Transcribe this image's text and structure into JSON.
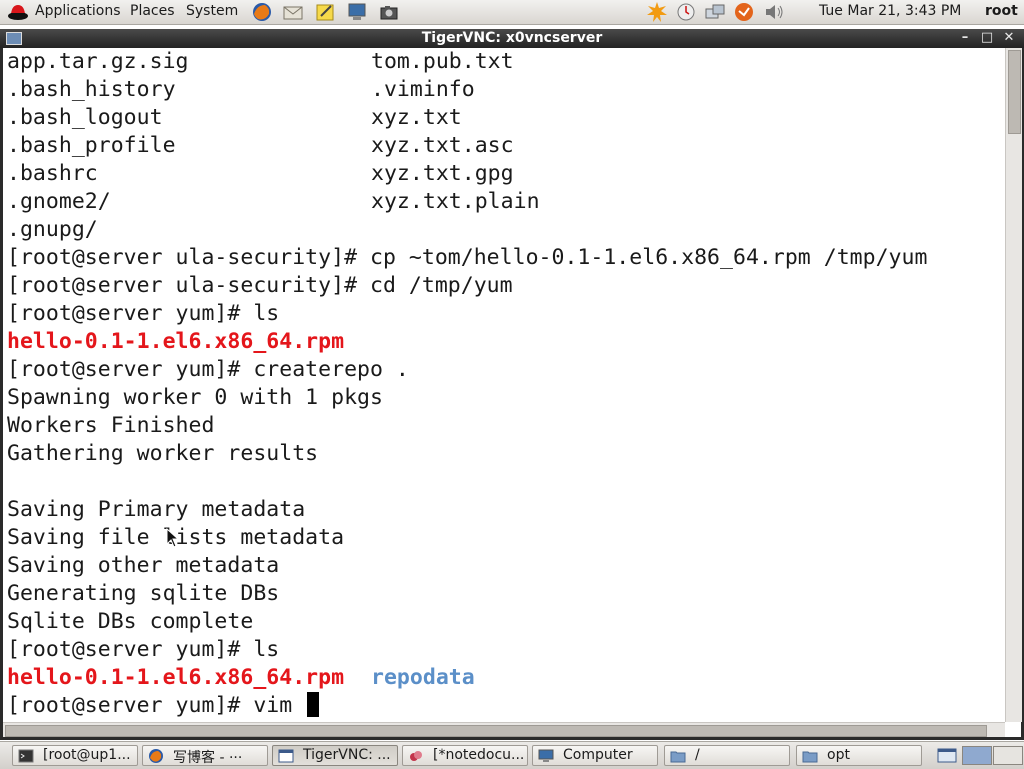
{
  "top_panel": {
    "menus": [
      "Applications",
      "Places",
      "System"
    ],
    "launchers": [
      "firefox-icon",
      "mail-icon",
      "notes-icon",
      "computer-icon",
      "camera-icon"
    ],
    "tray": [
      "update-icon",
      "clock-icon",
      "network-icon",
      "alert-icon",
      "volume-icon"
    ],
    "clock": "Tue Mar 21,  3:43 PM",
    "user": "root"
  },
  "window": {
    "title": "TigerVNC: x0vncserver",
    "controls": [
      "minimize-icon",
      "maximize-icon",
      "close-icon"
    ]
  },
  "terminal": {
    "lines": [
      {
        "col1": "app.tar.gz.sig",
        "col2": "tom.pub.txt"
      },
      {
        "col1": ".bash_history",
        "col2": ".viminfo"
      },
      {
        "col1": ".bash_logout",
        "col2": "xyz.txt"
      },
      {
        "col1": ".bash_profile",
        "col2": "xyz.txt.asc"
      },
      {
        "col1": ".bashrc",
        "col2": "xyz.txt.gpg"
      },
      {
        "col1": ".gnome2/",
        "col2": "xyz.txt.plain"
      },
      {
        "col1": ".gnupg/",
        "col2": ""
      }
    ],
    "cmd_cp": "[root@server ula-security]# cp ~tom/hello-0.1-1.el6.x86_64.rpm /tmp/yum",
    "cmd_cd": "[root@server ula-security]# cd /tmp/yum",
    "cmd_ls1": "[root@server yum]# ls",
    "rpm_file": "hello-0.1-1.el6.x86_64.rpm",
    "cmd_createrepo": "[root@server yum]# createrepo .",
    "out_spawning": "Spawning worker 0 with 1 pkgs",
    "out_workers": "Workers Finished",
    "out_gathering": "Gathering worker results",
    "out_primary": "Saving Primary metadata",
    "out_filelists": "Saving file lists metadata",
    "out_other": "Saving other metadata",
    "out_generating": "Generating sqlite DBs",
    "out_complete": "Sqlite DBs complete",
    "cmd_ls2": "[root@server yum]# ls",
    "rpm_file2": "hello-0.1-1.el6.x86_64.rpm",
    "repodata_dir": "repodata",
    "cmd_vim": "[root@server yum]# vim "
  },
  "taskbar": {
    "tasks": [
      {
        "label": "[root@up1...",
        "icon": "terminal-icon"
      },
      {
        "label": "写博客 - ···",
        "icon": "firefox-icon"
      },
      {
        "label": "TigerVNC: ...",
        "icon": "window-icon",
        "active": true
      },
      {
        "label": "[*notedocu...",
        "icon": "notes-icon"
      },
      {
        "label": "Computer",
        "icon": "computer-icon"
      },
      {
        "label": "/",
        "icon": "folder-icon"
      },
      {
        "label": "opt",
        "icon": "folder-icon"
      }
    ]
  }
}
